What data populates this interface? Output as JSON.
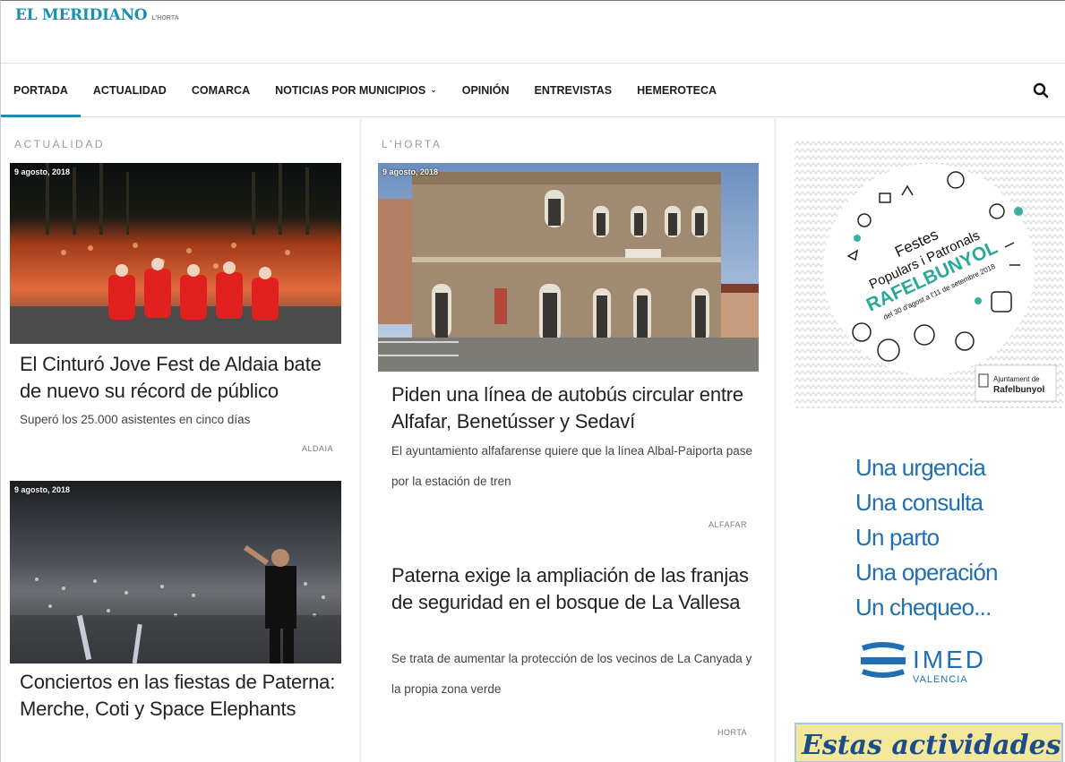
{
  "site": {
    "logo": "EL MERIDIANO",
    "logo_sub": "L'HORTA"
  },
  "nav": {
    "items": [
      "PORTADA",
      "ACTUALIDAD",
      "COMARCA",
      "NOTICIAS POR MUNICIPIOS",
      "OPINIÓN",
      "ENTREVISTAS",
      "HEMEROTECA"
    ],
    "active": "PORTADA",
    "dropdown_chevron": "⌄"
  },
  "col1": {
    "section": "ACTUALIDAD",
    "articles": [
      {
        "date": "9 agosto, 2018",
        "title": "El Cinturó Jove Fest de Aldaia bate de nuevo su récord de público",
        "subtitle": "Superó los 25.000 asistentes en cinco días",
        "tag": "ALDAIA"
      },
      {
        "date": "9 agosto, 2018",
        "title": "Conciertos en las fiestas de Paterna: Merche, Coti y Space Elephants"
      }
    ]
  },
  "col2": {
    "section": "L'HORTA",
    "articles": [
      {
        "date": "9 agosto, 2018",
        "title": "Piden una línea de autobús circular entre Alfafar, Benetússer y Sedaví",
        "subtitle": "El ayuntamiento alfafarense quiere que la línea Albal-Paiporta pase por la estación de tren",
        "tag": "ALFAFAR"
      },
      {
        "title": "Paterna exige la ampliación de las franjas de seguridad en el bosque de La Vallesa",
        "subtitle": "Se trata de aumentar la protección de los vecinos de La Canyada y la propia zona verde",
        "tag": "HORTA"
      }
    ]
  },
  "sidebar": {
    "ad1": {
      "line1": "Festes",
      "line2": "Populars i Patronals",
      "line3": "RAFELBUNYOL",
      "line4": "del 30 d'agost a l'11 de setembre 2018",
      "footer1": "Ajuntament de",
      "footer2": "Rafelbunyol"
    },
    "ad2": {
      "lines": [
        "Una urgencia",
        "Una consulta",
        "Un parto",
        "Una operación",
        "Un chequeo..."
      ],
      "brand": "IMED",
      "city": "VALENCIA"
    },
    "ad3": {
      "text": "Estas actividades"
    }
  },
  "colors": {
    "accent": "#1a8fae",
    "imed_blue": "#1f6fb2"
  }
}
